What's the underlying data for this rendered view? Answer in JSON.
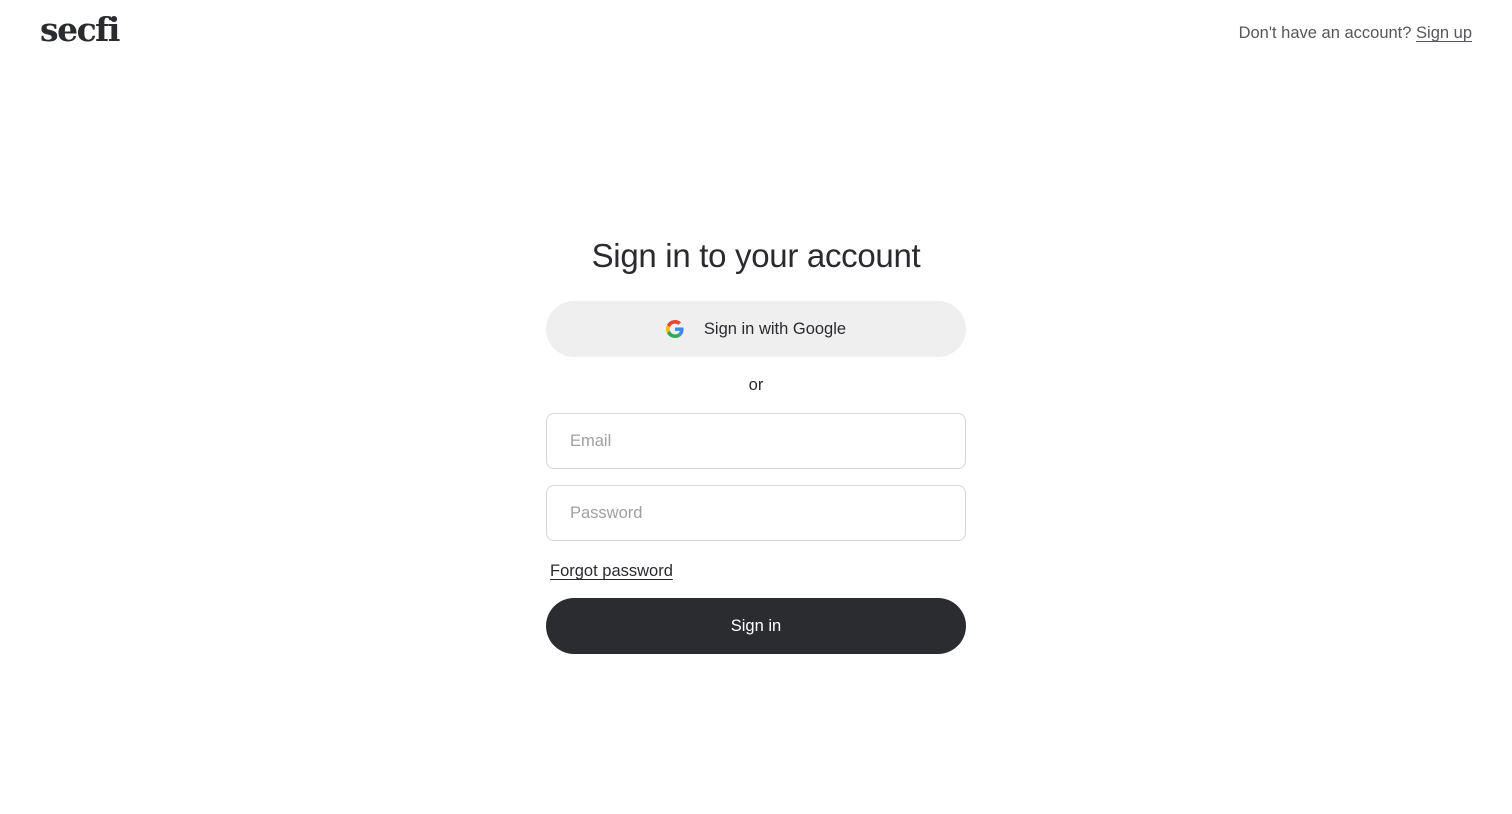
{
  "header": {
    "logo_text": "secfi",
    "account_prompt": "Don't have an account?",
    "signup_label": "Sign up"
  },
  "form": {
    "title": "Sign in to your account",
    "google_label": "Sign in with Google",
    "google_icon": "google-g-icon",
    "divider_text": "or",
    "email": {
      "value": "",
      "placeholder": "Email"
    },
    "password": {
      "value": "",
      "placeholder": "Password"
    },
    "forgot_label": "Forgot password",
    "submit_label": "Sign in"
  },
  "colors": {
    "primary_button": "#2b2c2f",
    "secondary_button": "#efeff0",
    "text": "#2a2b2f",
    "muted_text": "#55575c",
    "placeholder": "#9fa0a4",
    "border": "#d5d6d8"
  }
}
